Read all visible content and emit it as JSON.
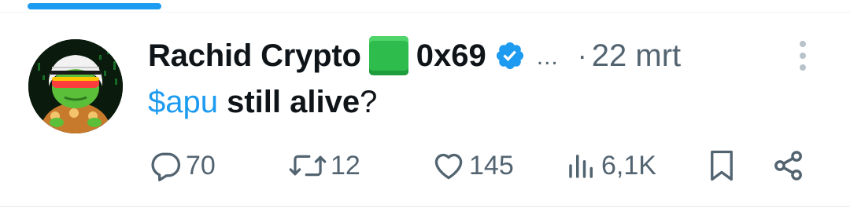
{
  "tweet": {
    "author": {
      "display_name": "Rachid Crypto",
      "emoji": "green-square-emoji",
      "handle_suffix": "0x69",
      "verified": true,
      "overflow": "...",
      "avatar": "apu-frog-avatar"
    },
    "separator": "·",
    "timestamp": "22 mrt",
    "text": {
      "cashtag": "$apu",
      "body": " still alive",
      "punctuation": "?"
    },
    "actions": {
      "replies": "70",
      "reposts": "12",
      "likes": "145",
      "views": "6,1K"
    }
  },
  "colors": {
    "accent": "#1d9bf0",
    "secondary_text": "#536471",
    "primary_text": "#0f1419"
  },
  "icons": [
    "reply-icon",
    "repost-icon",
    "like-icon",
    "views-icon",
    "bookmark-icon",
    "share-icon",
    "more-icon",
    "verified-icon"
  ]
}
